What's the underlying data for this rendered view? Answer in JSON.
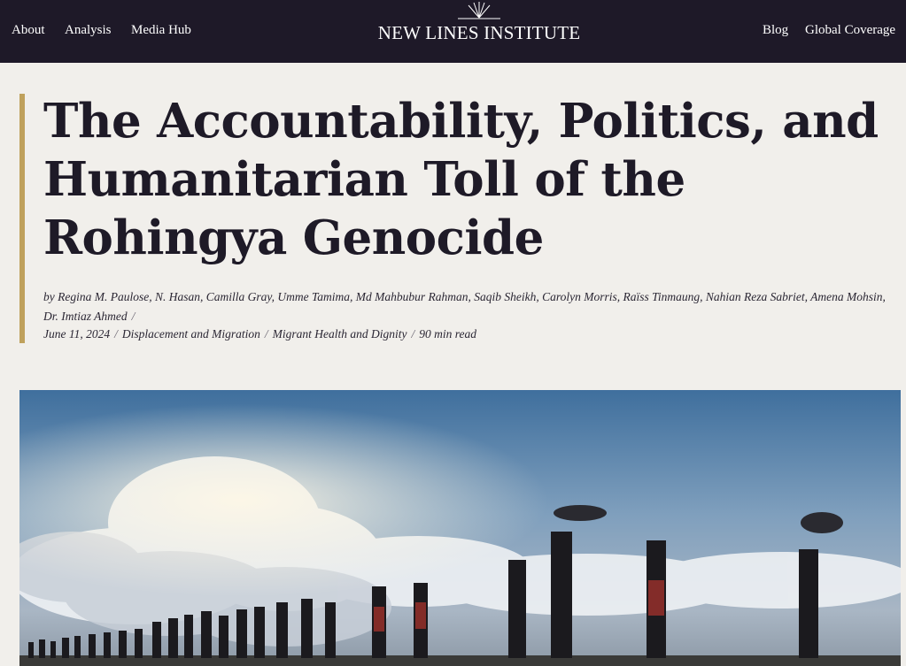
{
  "nav": {
    "left": [
      "About",
      "Analysis",
      "Media Hub"
    ],
    "right": [
      "Blog",
      "Global Coverage"
    ],
    "logo_text": "NEW LINES INSTITUTE"
  },
  "article": {
    "title": "The Accountability, Politics, and Humanitarian Toll of the Rohingya Genocide",
    "byline": "by Regina M. Paulose, N. Hasan, Camilla Gray, Umme Tamima, Md Mahbubur Rahman, Saqib Sheikh, Carolyn Morris, Raïss Tinmaung, Nahian Reza Sabriet, Amena Mohsin, Dr. Imtiaz Ahmed",
    "date": "June 11, 2024",
    "topics": [
      "Displacement and Migration",
      "Migrant Health and Dignity"
    ],
    "read_time": "90 min read"
  },
  "colors": {
    "header_bg": "#1e1928",
    "accent_rule": "#bfa15c",
    "page_bg": "#f1efeb"
  }
}
